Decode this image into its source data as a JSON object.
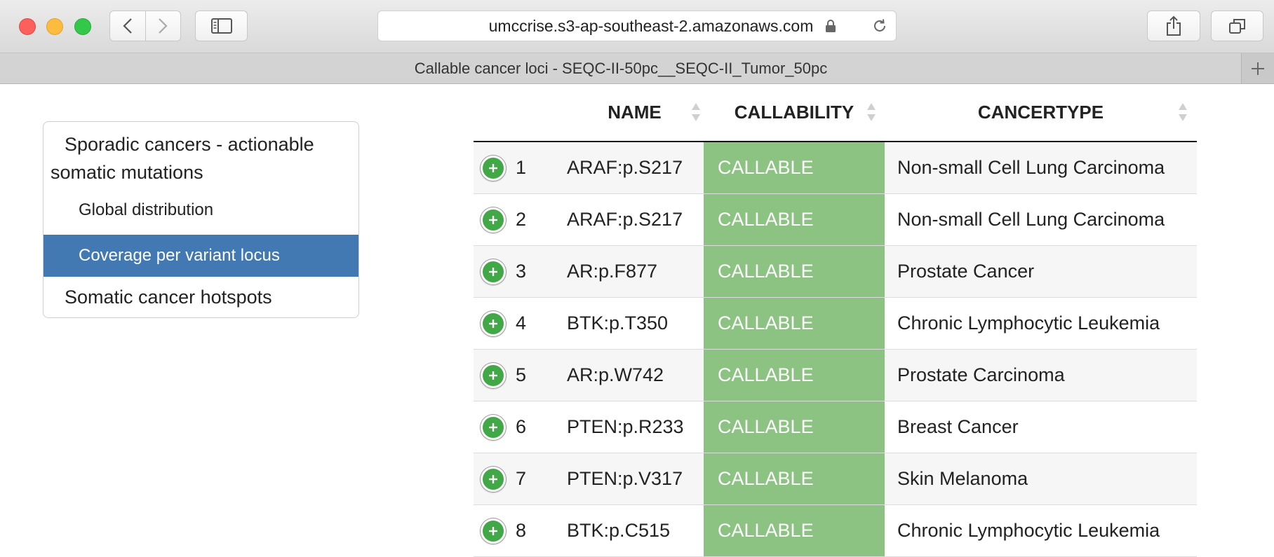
{
  "browser": {
    "url": "umccrise.s3-ap-southeast-2.amazonaws.com",
    "tab_title": "Callable cancer loci - SEQC-II-50pc__SEQC-II_Tumor_50pc"
  },
  "sidebar": {
    "section_title": "Sporadic cancers - actionable somatic mutations",
    "items": [
      {
        "label": "Global distribution",
        "active": false
      },
      {
        "label": "Coverage per variant locus",
        "active": true
      }
    ],
    "section2_title": "Somatic cancer hotspots"
  },
  "table": {
    "columns": [
      "NAME",
      "CALLABILITY",
      "CANCERTYPE"
    ],
    "rows": [
      {
        "idx": "1",
        "name": "ARAF:p.S217",
        "callability": "CALLABLE",
        "cancertype": "Non-small Cell Lung Carcinoma"
      },
      {
        "idx": "2",
        "name": "ARAF:p.S217",
        "callability": "CALLABLE",
        "cancertype": "Non-small Cell Lung Carcinoma"
      },
      {
        "idx": "3",
        "name": "AR:p.F877",
        "callability": "CALLABLE",
        "cancertype": "Prostate Cancer"
      },
      {
        "idx": "4",
        "name": "BTK:p.T350",
        "callability": "CALLABLE",
        "cancertype": "Chronic Lymphocytic Leukemia"
      },
      {
        "idx": "5",
        "name": "AR:p.W742",
        "callability": "CALLABLE",
        "cancertype": "Prostate Carcinoma"
      },
      {
        "idx": "6",
        "name": "PTEN:p.R233",
        "callability": "CALLABLE",
        "cancertype": "Breast Cancer"
      },
      {
        "idx": "7",
        "name": "PTEN:p.V317",
        "callability": "CALLABLE",
        "cancertype": "Skin Melanoma"
      },
      {
        "idx": "8",
        "name": "BTK:p.C515",
        "callability": "CALLABLE",
        "cancertype": "Chronic Lymphocytic Leukemia"
      }
    ]
  },
  "colors": {
    "active_nav": "#4379b3",
    "callable": "#8cc383",
    "expand_button": "#42a847"
  }
}
